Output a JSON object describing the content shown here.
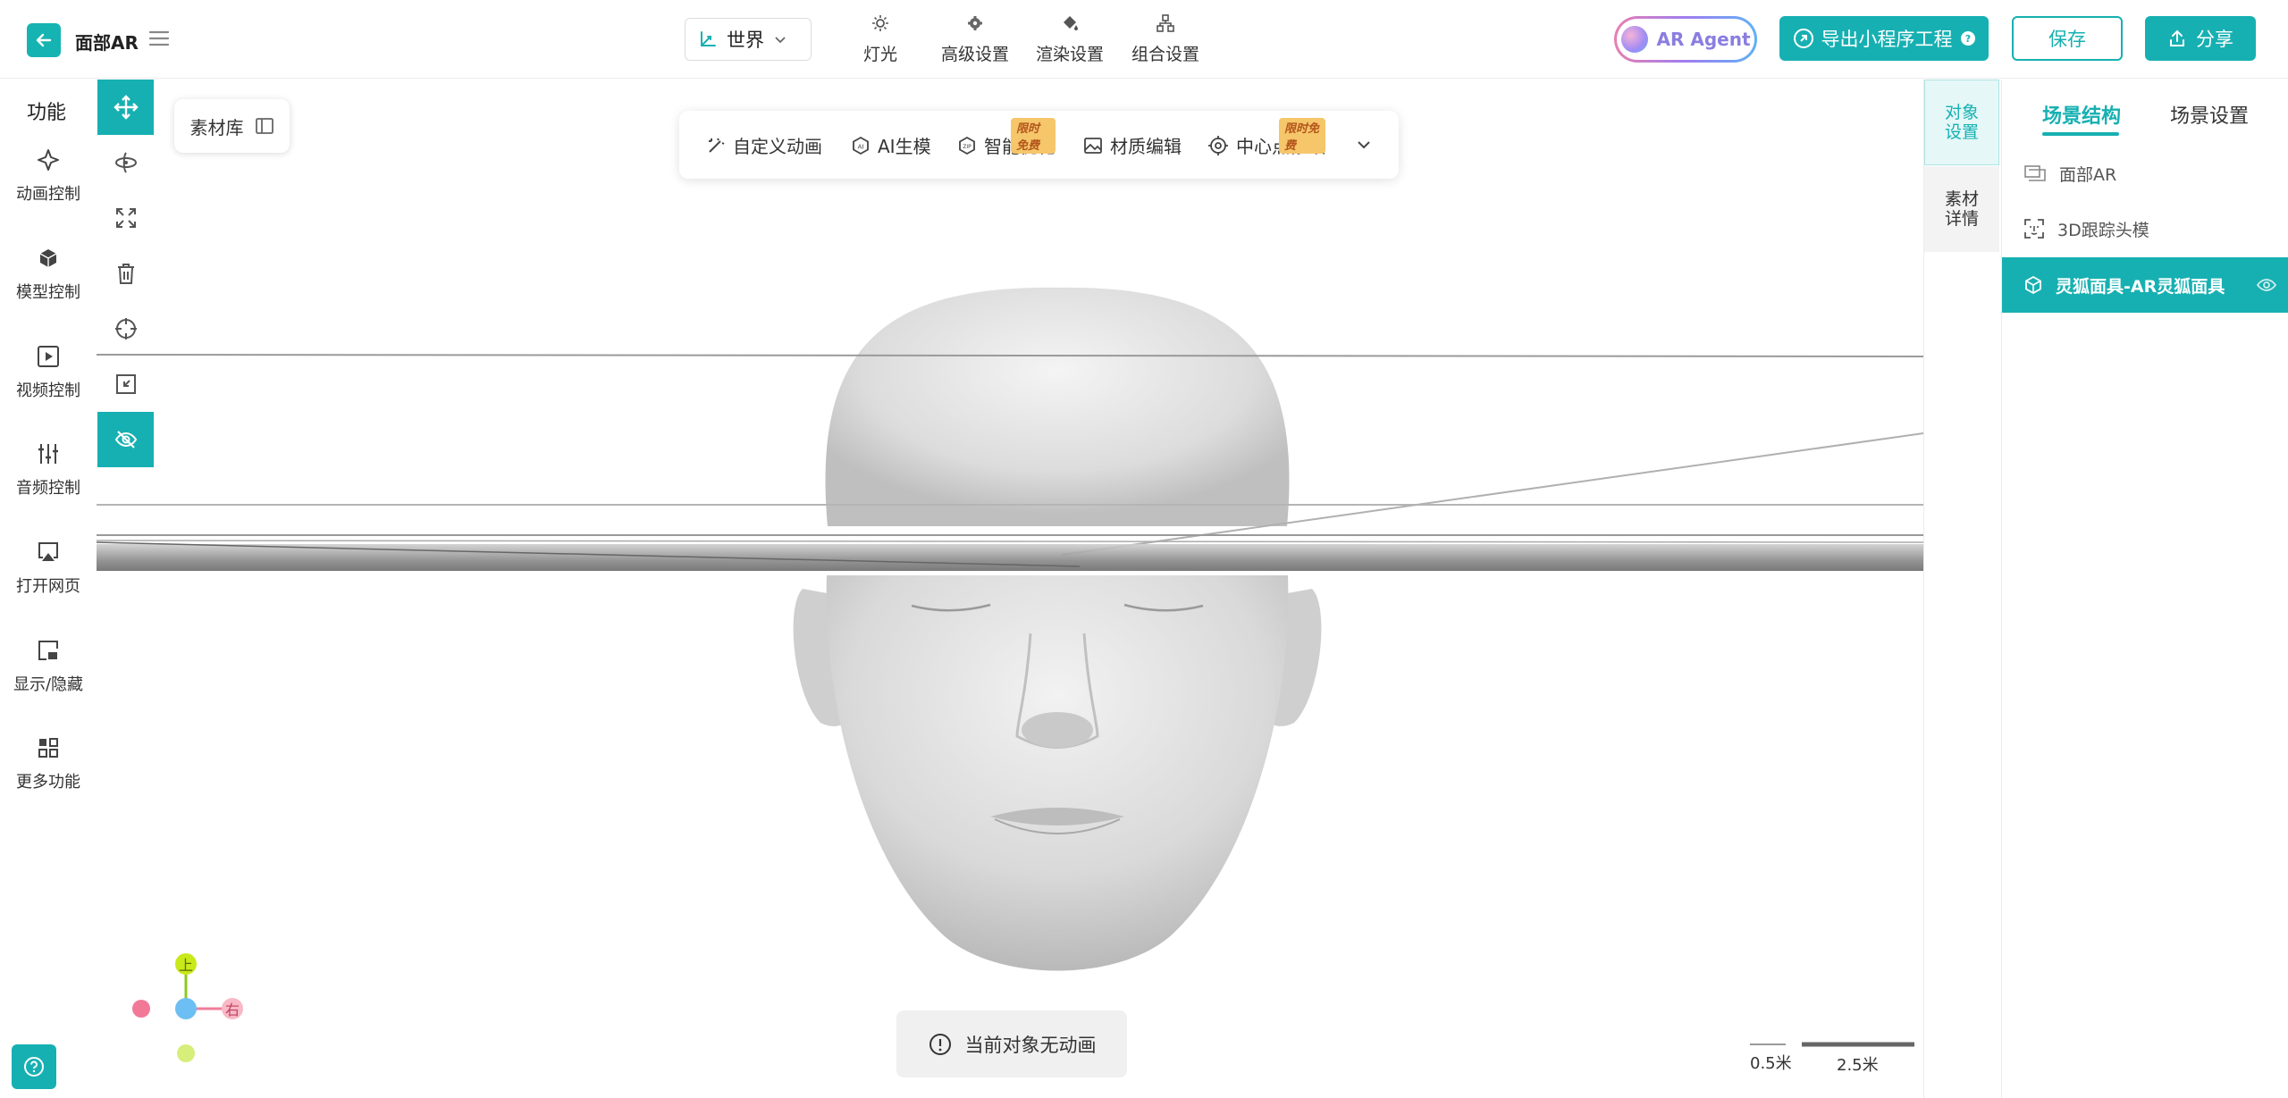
{
  "app": {
    "title": "面部AR"
  },
  "toolbar": {
    "coord_mode": "世界",
    "tools": [
      {
        "label": "灯光",
        "icon": "sun-icon"
      },
      {
        "label": "高级设置",
        "icon": "gear-icon"
      },
      {
        "label": "渲染设置",
        "icon": "paint-bucket-icon"
      },
      {
        "label": "组合设置",
        "icon": "hierarchy-icon"
      }
    ],
    "agent_label": "AR Agent",
    "export_label": "导出小程序工程",
    "save_label": "保存",
    "share_label": "分享"
  },
  "functions": {
    "heading": "功能",
    "items": [
      {
        "label": "动画控制",
        "icon": "sparkle-icon"
      },
      {
        "label": "模型控制",
        "icon": "cube-icon"
      },
      {
        "label": "视频控制",
        "icon": "play-icon"
      },
      {
        "label": "音频控制",
        "icon": "sliders-icon"
      },
      {
        "label": "打开网页",
        "icon": "airplay-icon"
      },
      {
        "label": "显示/隐藏",
        "icon": "picture-in-picture-icon"
      },
      {
        "label": "更多功能",
        "icon": "grid-icon"
      }
    ]
  },
  "transform_tools": [
    {
      "icon": "move-icon",
      "active": true
    },
    {
      "icon": "rotate-icon",
      "active": false
    },
    {
      "icon": "scale-icon",
      "active": false
    },
    {
      "icon": "trash-icon",
      "active": false
    },
    {
      "icon": "target-icon",
      "active": false
    },
    {
      "icon": "shrink-icon",
      "active": false
    },
    {
      "icon": "eye-off-icon",
      "active": true
    }
  ],
  "asset_library": {
    "label": "素材库"
  },
  "float_toolbar": {
    "items": [
      {
        "label": "自定义动画",
        "icon": "wand-icon"
      },
      {
        "label": "AI生模",
        "icon": "ai-cube-icon"
      },
      {
        "label": "智能优化",
        "icon": "zip-icon",
        "tag": "限时免费"
      },
      {
        "label": "材质编辑",
        "icon": "image-icon"
      },
      {
        "label": "中心点修改",
        "icon": "crosshair-icon",
        "tag": "限时免费"
      }
    ]
  },
  "gizmo": {
    "up_label": "上",
    "right_label": "右"
  },
  "status": {
    "no_animation": "当前对象无动画"
  },
  "scale_bar": {
    "small": "0.5米",
    "large": "2.5米"
  },
  "side_tabs": {
    "object": "对象设置",
    "asset": "素材详情"
  },
  "scene_panel": {
    "tabs": [
      "场景结构",
      "场景设置"
    ],
    "tree": [
      {
        "label": "面部AR",
        "icon": "folder-icon",
        "selected": false
      },
      {
        "label": "3D跟踪头模",
        "icon": "face-scan-icon",
        "selected": false
      },
      {
        "label": "灵狐面具-AR灵狐面具",
        "icon": "cube-outline-icon",
        "selected": true
      }
    ]
  },
  "colors": {
    "accent": "#17b0b2",
    "tag_bg": "#f6c66a"
  }
}
